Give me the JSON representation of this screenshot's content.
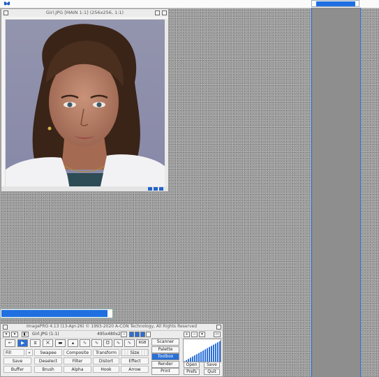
{
  "menubar": {
    "app_icon": "butterfly-icon"
  },
  "image_window": {
    "title": "Girl.JPG [MAIN  1:1] (256x256, 1:1)",
    "icons": [
      "restore-icon",
      "close-icon"
    ]
  },
  "toolbox": {
    "title": "ImagePRO 4.13 (13-Apr-26)  © 1993-2020 A-CON Technology, All Rights Reserved",
    "image_name": "Girl.JPG (1:1)",
    "image_size": "495x480x24",
    "tools": [
      "←",
      "▶",
      "⧖",
      "⨉",
      "▬",
      "▴",
      "∿",
      "∿",
      "℧",
      "∿",
      "∿",
      "RGB"
    ],
    "commands": [
      [
        "Fill",
        "Swapee",
        "Composite",
        "Transform",
        "Size"
      ],
      [
        "Save",
        "Deselect",
        "Filter",
        "Distort",
        "Effect"
      ],
      [
        "Buffer",
        "Brush",
        "Alpha",
        "Hook",
        "Arrow"
      ]
    ],
    "side_menu": [
      "Scanner",
      "Palette",
      "Toolbox",
      "Render",
      "Print"
    ],
    "file_buttons": [
      [
        "Open",
        "Save"
      ],
      [
        "Prefs",
        "Quit"
      ]
    ]
  },
  "progress": {
    "value_percent": 96
  },
  "colors": {
    "accent": "#1f6fe0",
    "desktop": "#9a9a9a",
    "panel": "#8e8e8e"
  }
}
